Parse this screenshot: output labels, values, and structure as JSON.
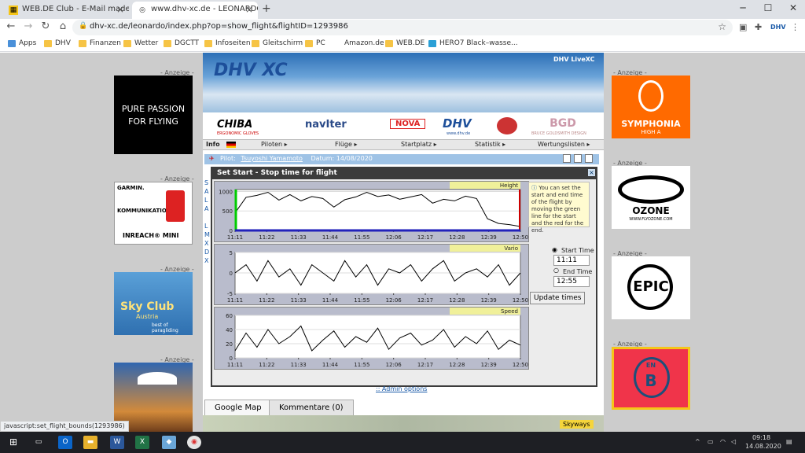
{
  "browser": {
    "tabs": [
      {
        "title": "WEB.DE Club - E-Mail made in Ge"
      },
      {
        "title": "www.dhv-xc.de - LEONARDO"
      }
    ],
    "new_tab": "+",
    "url": "dhv-xc.de/leonardo/index.php?op=show_flight&flightID=1293986",
    "bookmarks": [
      "Apps",
      "DHV",
      "Finanzen",
      "Wetter",
      "DGCTT",
      "Infoseiten",
      "Gleitschirm",
      "PC",
      "Amazon.de",
      "WEB.DE",
      "HERO7 Black–wasse..."
    ]
  },
  "ads": {
    "label": "- Anzeige -",
    "left": [
      "PURE PASSION FOR FLYING",
      "KOMMUNIKATION",
      "INREACH® MINI",
      "GARMIN.",
      "Sky Club",
      "Austria",
      "best of paragliding"
    ],
    "right": [
      "SYMPHONIA",
      "HIGH A",
      "OZONE",
      "WWW.FLYOZONE.COM",
      "EPIC",
      "EN",
      "B"
    ]
  },
  "site": {
    "logo": "DHV XC",
    "livexc": "DHV LiveXC",
    "sponsors": [
      "CHIBA",
      "ERGONOMIC GLOVES",
      "navIter",
      "NOVA",
      "DHV",
      "www.dhv.de",
      "BRUCE GOLDSMITH DESIGN"
    ],
    "menu": [
      "Info",
      "Piloten ▸",
      "Flüge ▸",
      "Startplatz ▸",
      "Statistik ▸",
      "Wertungslisten ▸"
    ],
    "pilot_label": "Pilot:",
    "pilot_name": "Tsuyoshi Yamamoto",
    "date_label": "Datum:",
    "date": "14/08/2020"
  },
  "dialog": {
    "title": "Set Start - Stop time for flight",
    "help": "You can set the start and end time of the flight by moving the green line for the start and the red for the end.",
    "start_label": "Start Time",
    "start_value": "11:11",
    "end_label": "End Time",
    "end_value": "12:55",
    "update_button": "Update times",
    "admin_link": ":: Admin options"
  },
  "chart_data": [
    {
      "type": "line",
      "title": "Height",
      "x": [
        "11:11",
        "11:22",
        "11:33",
        "11:44",
        "11:55",
        "12:06",
        "12:17",
        "12:28",
        "12:39",
        "12:50"
      ],
      "yticks": [
        0,
        500,
        1000
      ],
      "ylim": [
        0,
        1050
      ],
      "values": [
        450,
        850,
        900,
        980,
        780,
        920,
        760,
        870,
        820,
        600,
        790,
        860,
        980,
        870,
        910,
        800,
        860,
        920,
        700,
        800,
        760,
        880,
        820,
        300,
        180,
        150,
        100
      ]
    },
    {
      "type": "line",
      "title": "Vario",
      "x": [
        "11:11",
        "11:22",
        "11:33",
        "11:44",
        "11:55",
        "12:06",
        "12:17",
        "12:28",
        "12:39",
        "12:50"
      ],
      "yticks": [
        5,
        0,
        -5
      ],
      "ylim": [
        -5,
        5
      ],
      "values": [
        0,
        2,
        -2,
        3,
        -1,
        1,
        -3,
        2,
        0,
        -2,
        3,
        -1,
        2,
        -3,
        1,
        0,
        2,
        -2,
        1,
        3,
        -2,
        0,
        1,
        -1,
        2,
        -3,
        0
      ]
    },
    {
      "type": "line",
      "title": "Speed",
      "x": [
        "11:11",
        "11:22",
        "11:33",
        "11:44",
        "11:55",
        "12:06",
        "12:17",
        "12:28",
        "12:39",
        "12:50"
      ],
      "yticks": [
        60,
        40,
        20,
        0
      ],
      "ylim": [
        0,
        60
      ],
      "values": [
        10,
        35,
        15,
        40,
        20,
        30,
        45,
        10,
        25,
        38,
        15,
        30,
        22,
        42,
        12,
        28,
        35,
        18,
        25,
        40,
        15,
        30,
        20,
        38,
        12,
        25,
        18
      ]
    }
  ],
  "bottom_tabs": [
    "Google Map",
    "Kommentare (0)"
  ],
  "map_label": "Skyways",
  "status_text": "javascript:set_flight_bounds(1293986)",
  "taskbar": {
    "time": "09:18",
    "date": "14.08.2020"
  },
  "colors": {
    "accent": "#ff6a00",
    "height": "#000000",
    "start": "#00cc00",
    "end": "#cc0000"
  }
}
